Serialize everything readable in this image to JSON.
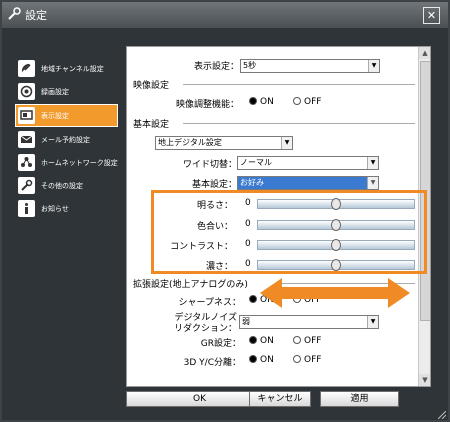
{
  "window": {
    "title": "設定",
    "close_label": "✕"
  },
  "sidebar": {
    "items": [
      {
        "label": "地域チャンネル設定",
        "icon": "satellite-dish-icon",
        "active": false
      },
      {
        "label": "録画設定",
        "icon": "record-icon",
        "active": false
      },
      {
        "label": "表示設定",
        "icon": "display-icon",
        "active": true
      },
      {
        "label": "メール予約設定",
        "icon": "mail-icon",
        "active": false
      },
      {
        "label": "ホームネットワーク設定",
        "icon": "network-icon",
        "active": false
      },
      {
        "label": "その他の設定",
        "icon": "wrench-icon",
        "active": false
      },
      {
        "label": "お知らせ",
        "icon": "info-icon",
        "active": false
      }
    ]
  },
  "panel": {
    "display_setting_label": "表示設定：",
    "display_setting_value": "5秒",
    "video_section": {
      "heading": "映像設定",
      "adjust_label": "映像調整機能：",
      "on": "ON",
      "off": "OFF",
      "selected": "ON"
    },
    "basic_section": {
      "heading": "基本設定",
      "source_value": "地上デジタル設定",
      "wide_label": "ワイド切替：",
      "wide_value": "ノーマル",
      "basic_label": "基本設定：",
      "basic_value": "お好み",
      "sliders": [
        {
          "label": "明るさ：",
          "value": "0",
          "level": 0.5
        },
        {
          "label": "色合い：",
          "value": "0",
          "level": 0.5
        },
        {
          "label": "コントラスト：",
          "value": "0",
          "level": 0.5
        },
        {
          "label": "濃さ：",
          "value": "0",
          "level": 0.5
        }
      ]
    },
    "ext_section": {
      "heading": "拡張設定(地上アナログのみ)",
      "sharpness_label": "シャープネス：",
      "noise_label_1": "デジタルノイズ",
      "noise_label_2": "リダクション：",
      "noise_value": "弱",
      "gr_label": "GR設定：",
      "yc_label": "3D Y/C分離：",
      "on": "ON",
      "off": "OFF"
    }
  },
  "buttons": {
    "ok": "OK",
    "cancel": "キャンセル",
    "apply": "適用"
  },
  "colors": {
    "accent": "#f39a2c",
    "highlight_box": "#f08a24",
    "selection": "#3a7ad1",
    "window_bg": "#2f3438"
  }
}
